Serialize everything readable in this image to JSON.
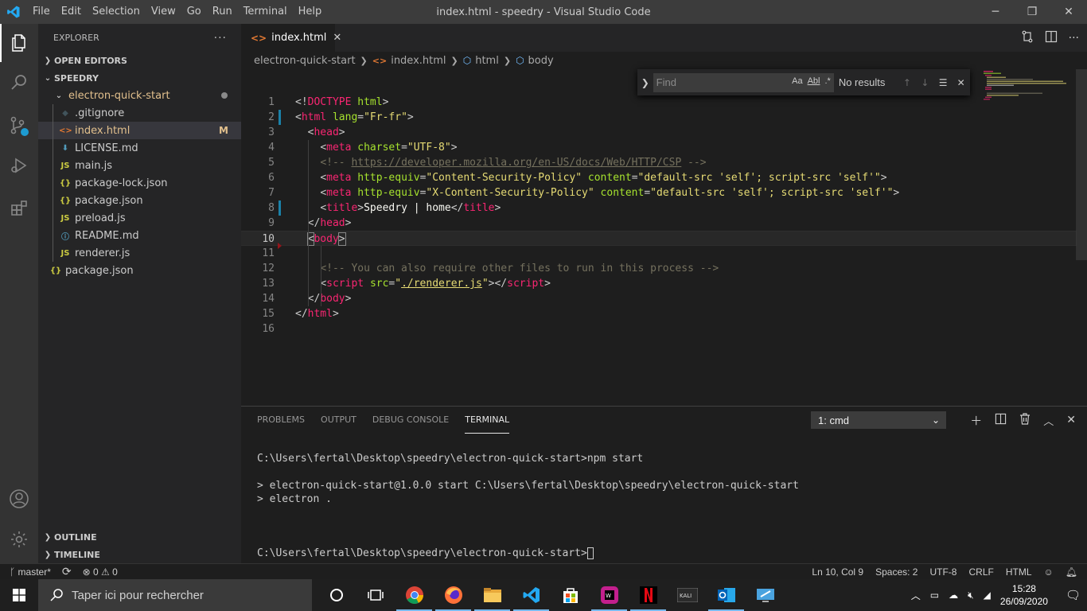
{
  "window": {
    "title": "index.html - speedry - Visual Studio Code",
    "menu": [
      "File",
      "Edit",
      "Selection",
      "View",
      "Go",
      "Run",
      "Terminal",
      "Help"
    ]
  },
  "sidebar": {
    "header": "EXPLORER",
    "sections": {
      "open_editors": "OPEN EDITORS",
      "workspace": "SPEEDRY",
      "outline": "OUTLINE",
      "timeline": "TIMELINE"
    },
    "tree": [
      {
        "label": "electron-quick-start",
        "icon": "chevron-down-icon",
        "glyph": "⌄",
        "color": "#cccccc"
      },
      {
        "label": ".gitignore",
        "icon": "git-file-icon",
        "glyph": "◆",
        "color": "#41535b"
      },
      {
        "label": "index.html",
        "icon": "html-file-icon",
        "glyph": "<>",
        "color": "#e37933",
        "badge": "M"
      },
      {
        "label": "LICENSE.md",
        "icon": "license-file-icon",
        "glyph": "⬇",
        "color": "#519aba"
      },
      {
        "label": "main.js",
        "icon": "js-file-icon",
        "glyph": "JS",
        "color": "#cbcb41"
      },
      {
        "label": "package-lock.json",
        "icon": "json-file-icon",
        "glyph": "{}",
        "color": "#cbcb41"
      },
      {
        "label": "package.json",
        "icon": "json-file-icon",
        "glyph": "{}",
        "color": "#cbcb41"
      },
      {
        "label": "preload.js",
        "icon": "js-file-icon",
        "glyph": "JS",
        "color": "#cbcb41"
      },
      {
        "label": "README.md",
        "icon": "info-file-icon",
        "glyph": "ⓘ",
        "color": "#519aba"
      },
      {
        "label": "renderer.js",
        "icon": "js-file-icon",
        "glyph": "JS",
        "color": "#cbcb41"
      },
      {
        "label": "package.json",
        "icon": "json-file-icon",
        "glyph": "{}",
        "color": "#cbcb41"
      }
    ]
  },
  "editor": {
    "tab_label": "index.html",
    "breadcrumb": [
      "electron-quick-start",
      "index.html",
      "html",
      "body"
    ],
    "line_numbers": [
      "1",
      "2",
      "3",
      "4",
      "5",
      "6",
      "7",
      "8",
      "9",
      "10",
      "11",
      "12",
      "13",
      "14",
      "15",
      "16"
    ],
    "current_line": "10"
  },
  "find": {
    "placeholder": "Find",
    "opt_case": "Aa",
    "opt_word": "Abl",
    "opt_regex": ".*",
    "result": "No results"
  },
  "panel": {
    "tabs": [
      "PROBLEMS",
      "OUTPUT",
      "DEBUG CONSOLE",
      "TERMINAL"
    ],
    "terminal_select": "1: cmd",
    "terminal_lines": [
      "C:\\Users\\fertal\\Desktop\\speedry\\electron-quick-start>npm start",
      "",
      "> electron-quick-start@1.0.0 start C:\\Users\\fertal\\Desktop\\speedry\\electron-quick-start",
      "> electron .",
      "",
      "",
      "",
      "C:\\Users\\fertal\\Desktop\\speedry\\electron-quick-start>"
    ]
  },
  "statusbar": {
    "branch": "master*",
    "errors": "0",
    "warnings": "0",
    "position": "Ln 10, Col 9",
    "spaces": "Spaces: 2",
    "encoding": "UTF-8",
    "eol": "CRLF",
    "language": "HTML"
  },
  "taskbar": {
    "search_placeholder": "Taper ici pour rechercher",
    "time": "15:28",
    "date": "26/09/2020",
    "kali_label": "KALI"
  },
  "colors": {
    "accent": "#007acc",
    "tag": "#f92672",
    "attr": "#a6e22e",
    "string": "#e6db74",
    "comment": "#75715e"
  }
}
